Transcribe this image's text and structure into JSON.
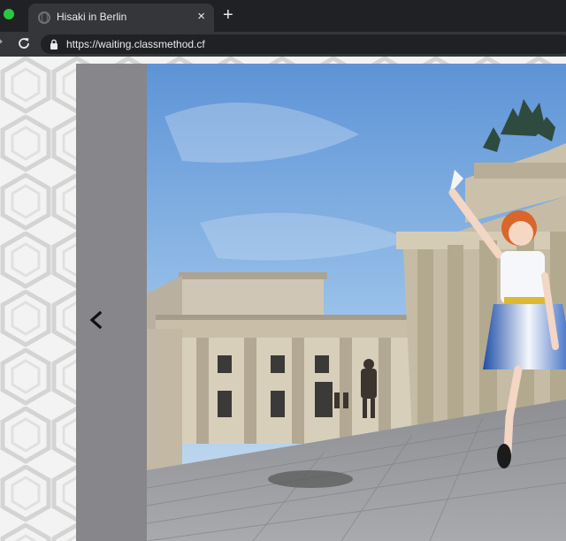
{
  "browser": {
    "tab": {
      "title": "Hisaki in Berlin",
      "close_symbol": "×",
      "favicon": "globe-icon"
    },
    "new_tab_symbol": "+",
    "address_bar": {
      "url": "https://waiting.classmethod.cf",
      "secure_icon": "lock-icon"
    },
    "colors": {
      "frame": "#202124",
      "toolbar": "#35363a",
      "traffic_light": "#28c840"
    }
  },
  "gallery": {
    "prev_icon": "chevron-left-icon",
    "photo": {
      "subject": "cosplayer posing in front of Brandenburg Gate",
      "colors": {
        "sky": "#86b4e6",
        "stone": "#c9bfa8",
        "pavement": "#9a9a9c"
      }
    }
  }
}
